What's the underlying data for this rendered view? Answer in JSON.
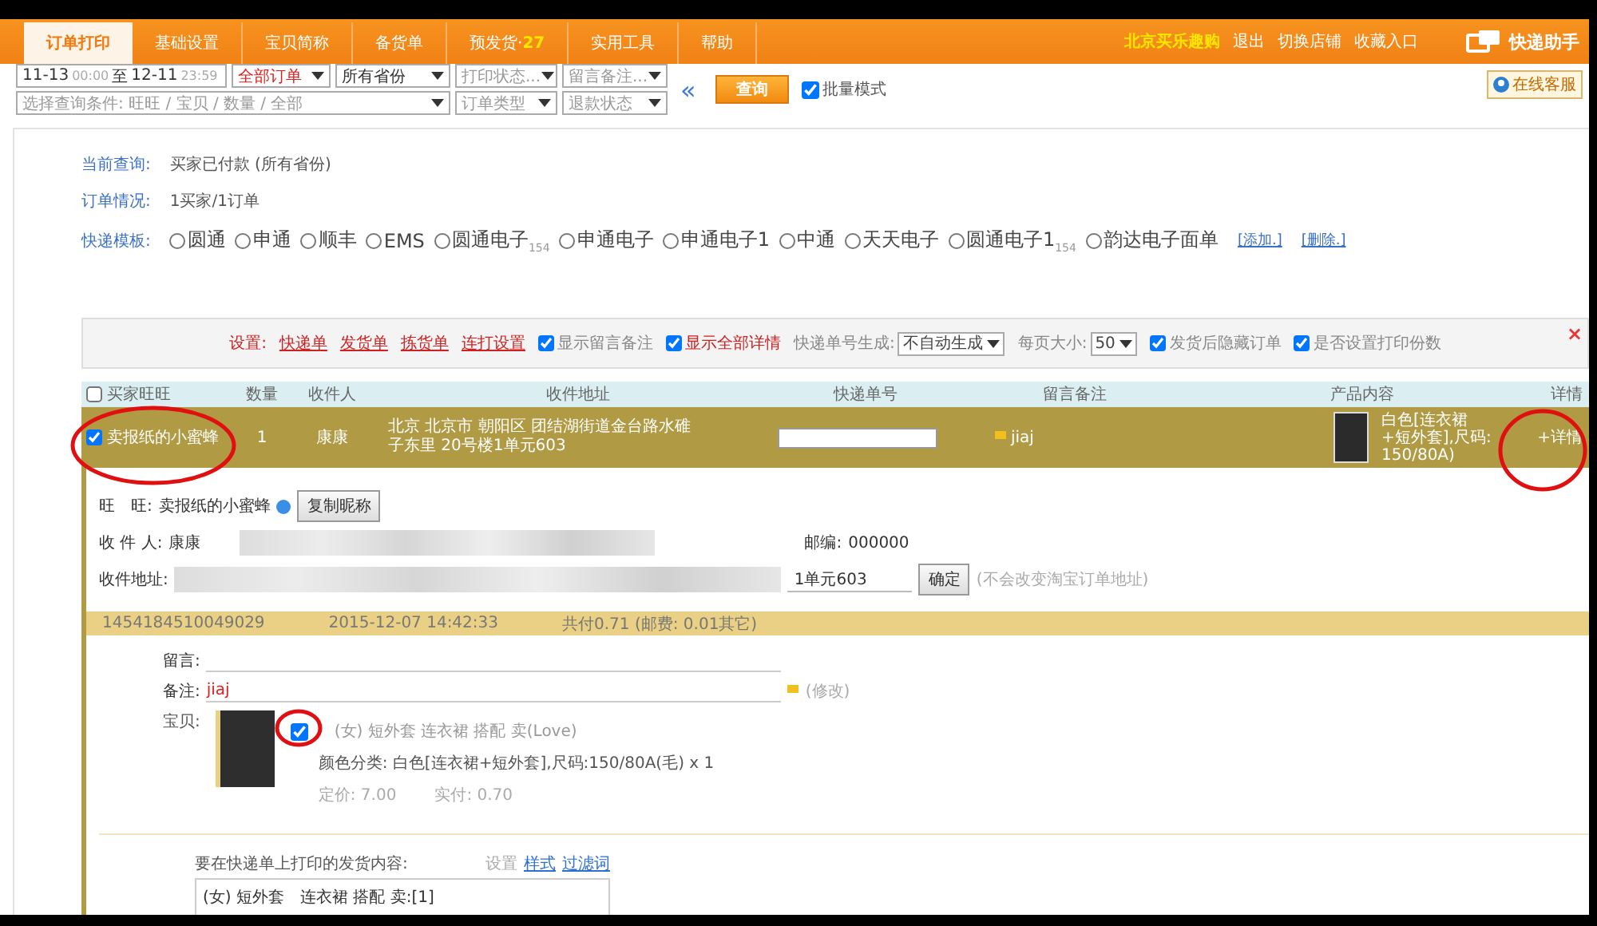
{
  "nav": {
    "tabs": [
      {
        "label": "订单打印",
        "selected": true
      },
      {
        "label": "基础设置",
        "selected": false
      },
      {
        "label": "宝贝简称",
        "selected": false
      },
      {
        "label": "备货单",
        "selected": false
      },
      {
        "label": "预发货·",
        "count": "27",
        "selected": false
      },
      {
        "label": "实用工具",
        "selected": false
      },
      {
        "label": "帮助",
        "selected": false
      }
    ],
    "shop_name": "北京买乐趣购",
    "links": [
      "退出",
      "切换店铺",
      "收藏入口"
    ],
    "app_name": "快递助手"
  },
  "filters": {
    "date_from": "11-13",
    "time_from": "00:00",
    "date_sep": "至",
    "date_to": "12-11",
    "time_to": "23:59",
    "selects": [
      {
        "value": "全部订单",
        "kind": "alert"
      },
      {
        "value": "所有省份",
        "kind": "value"
      },
      {
        "value": "打印状态...",
        "kind": "placeholder"
      },
      {
        "value": "留言备注...",
        "kind": "placeholder"
      },
      {
        "value": "选择查询条件: 旺旺 / 宝贝 / 数量 / 全部",
        "kind": "placeholder"
      },
      {
        "value": "订单类型",
        "kind": "placeholder"
      },
      {
        "value": "退款状态",
        "kind": "placeholder"
      }
    ],
    "collapse": "«",
    "search_button": "查询",
    "batch_mode": {
      "label": "批量模式",
      "checked": true
    },
    "online_service": "在线客服"
  },
  "info": {
    "rows": [
      {
        "label": "当前查询:",
        "value": "买家已付款 (所有省份)"
      },
      {
        "label": "订单情况:",
        "value": "1买家/1订单"
      }
    ],
    "templates_label": "快递模板:",
    "templates": [
      {
        "name": "圆通",
        "selected": false
      },
      {
        "name": "申通",
        "selected": false
      },
      {
        "name": "顺丰",
        "selected": false
      },
      {
        "name": "EMS",
        "selected": false
      },
      {
        "name": "圆通电子",
        "count": "154",
        "selected": false
      },
      {
        "name": "申通电子",
        "selected": false
      },
      {
        "name": "申通电子1",
        "selected": false
      },
      {
        "name": "中通",
        "selected": false
      },
      {
        "name": "天天电子",
        "selected": false
      },
      {
        "name": "圆通电子1",
        "count": "154",
        "selected": false
      },
      {
        "name": "韵达电子面单",
        "selected": false
      }
    ],
    "template_links": [
      "[添加.]",
      "[删除.]"
    ]
  },
  "settings": {
    "label": "设置:",
    "links": [
      "快递单",
      "发货单",
      "拣货单",
      "连打设置"
    ],
    "options": [
      {
        "kind": "checkbox",
        "label": "显示留言备注",
        "checked": true,
        "emphasis": false
      },
      {
        "kind": "checkbox",
        "label": "显示全部详情",
        "checked": true,
        "emphasis": true
      },
      {
        "kind": "select",
        "label": "快递单号生成:",
        "value": "不自动生成"
      },
      {
        "kind": "select",
        "label": "每页大小:",
        "value": "50"
      },
      {
        "kind": "checkbox",
        "label": "发货后隐藏订单",
        "checked": true,
        "emphasis": false
      },
      {
        "kind": "checkbox",
        "label": "是否设置打印份数",
        "checked": true,
        "emphasis": false
      }
    ],
    "close": "×"
  },
  "table": {
    "header_checked": false,
    "columns": [
      "买家旺旺",
      "数量",
      "收件人",
      "收件地址",
      "快递单号",
      "留言备注",
      "产品内容",
      "详情"
    ],
    "rows": [
      {
        "selected": true,
        "checked": true,
        "buyer": "卖报纸的小蜜蜂",
        "quantity": "1",
        "recipient": "康康",
        "address": "北京 北京市 朝阳区 团结湖街道金台路水碓子东里 20号楼1单元603",
        "remark": "jiaj",
        "product": "白色[连衣裙+短外套],尺码: 150/80A)",
        "detail": "+详情"
      }
    ]
  },
  "detail": {
    "wangwang_label": "旺　旺:",
    "wangwang": "卖报纸的小蜜蜂",
    "copy_button": "复制昵称",
    "recipient_label": "收 件 人:",
    "recipient": "康康",
    "postcode_label": "邮编:",
    "postcode": "000000",
    "address_label": "收件地址:",
    "address_value": "1单元603",
    "confirm_button": "确定",
    "address_note": "(不会改变淘宝订单地址)",
    "order": {
      "id": "1454184510049029",
      "time": "2015-12-07 14:42:33",
      "paid": "共付0.71 (邮费: 0.01其它)"
    },
    "message_label": "留言:",
    "remark_label": "备注:",
    "remark": "jiaj",
    "edit_link": "(修改)",
    "item_label": "宝贝:",
    "item": {
      "checked": true,
      "title": "(女) 短外套 连衣裙 搭配 卖(Love)",
      "spec": "颜色分类: 白色[连衣裙+短外套],尺码:150/80A(毛)   x 1",
      "price": "定价: 7.00",
      "paid": "实付: 0.70"
    },
    "print_label": "要在快递单上打印的发货内容:",
    "print_links": [
      {
        "label": "设置",
        "disabled": true
      },
      {
        "label": "样式",
        "disabled": false
      },
      {
        "label": "过滤词",
        "disabled": false
      }
    ],
    "print_content": "(女) 短外套　连衣裙 搭配 卖:[1]"
  }
}
